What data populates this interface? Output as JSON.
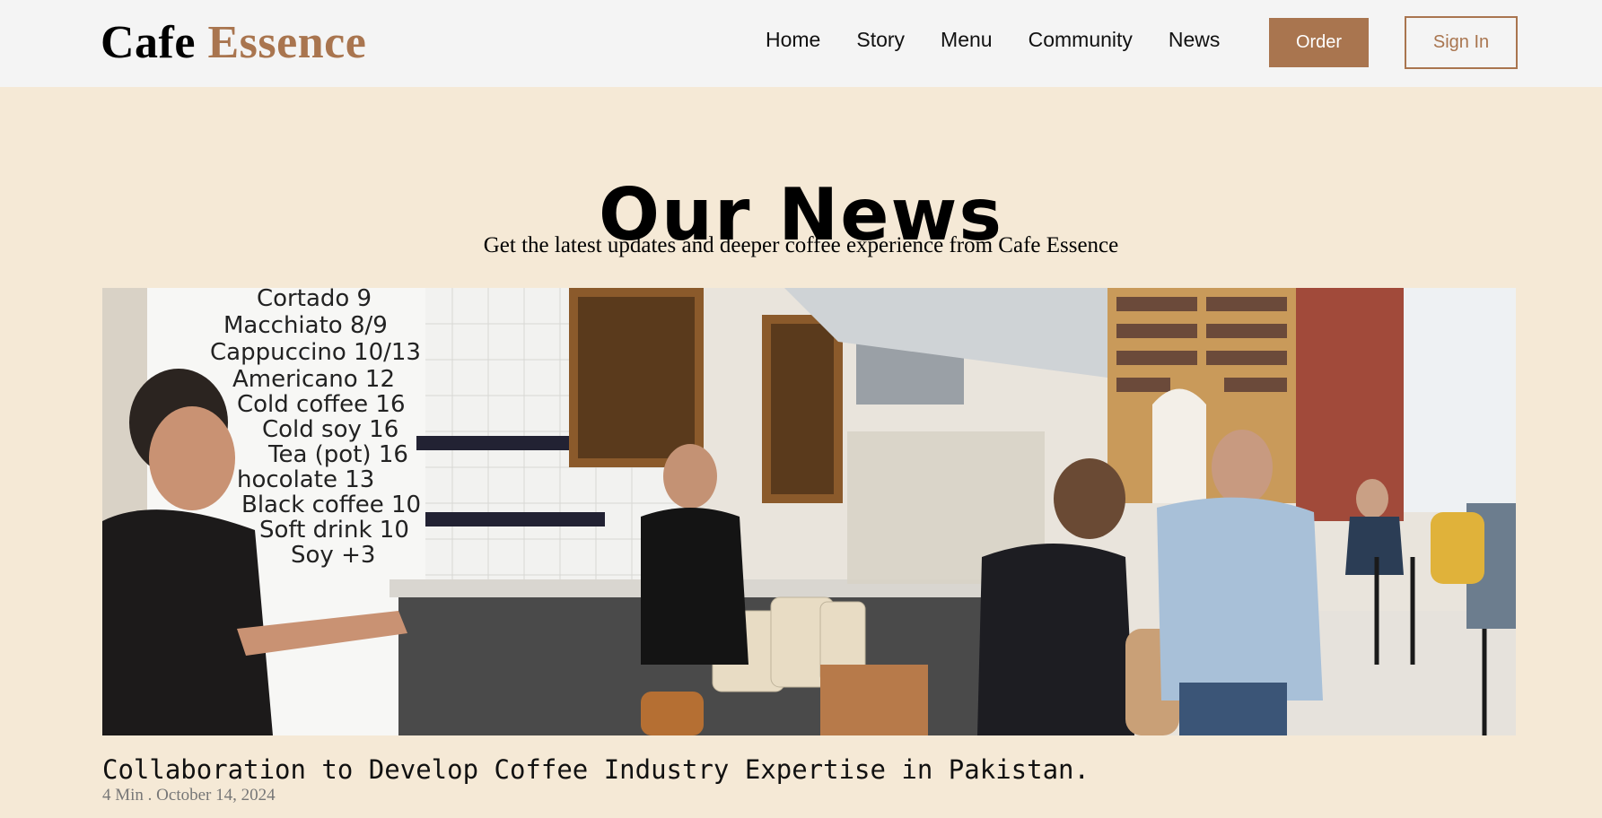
{
  "header": {
    "logo_word1": "Cafe",
    "logo_word2": "Essence",
    "nav": [
      "Home",
      "Story",
      "Menu",
      "Community",
      "News"
    ],
    "order_label": "Order",
    "signin_label": "Sign In"
  },
  "hero": {
    "title": "Our News",
    "subtitle": "Get the latest updates and deeper coffee experience from Cafe Essence"
  },
  "photo": {
    "menu_board": [
      "Cortado 9",
      "Macchiato 8/9",
      "Cappuccino 10/13",
      "Americano 12",
      "Cold coffee 16",
      "Cold soy 16",
      "Tea (pot) 16",
      "hocolate 13",
      "Black coffee 10",
      "Soft drink 10",
      "Soy +3"
    ]
  },
  "article": {
    "title": "Collaboration to Develop Coffee Industry Expertise in Pakistan.",
    "meta": "4 Min . October 14, 2024"
  },
  "colors": {
    "accent": "#a9754f",
    "page_bg": "#f5e9d6",
    "header_bg": "#f4f4f4"
  }
}
